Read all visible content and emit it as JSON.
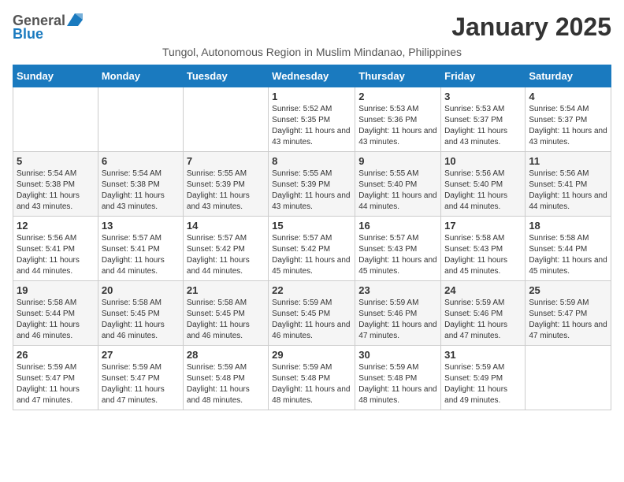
{
  "header": {
    "logo_general": "General",
    "logo_blue": "Blue",
    "month_title": "January 2025",
    "subtitle": "Tungol, Autonomous Region in Muslim Mindanao, Philippines"
  },
  "weekdays": [
    "Sunday",
    "Monday",
    "Tuesday",
    "Wednesday",
    "Thursday",
    "Friday",
    "Saturday"
  ],
  "weeks": [
    [
      {
        "day": "",
        "sunrise": "",
        "sunset": "",
        "daylight": ""
      },
      {
        "day": "",
        "sunrise": "",
        "sunset": "",
        "daylight": ""
      },
      {
        "day": "",
        "sunrise": "",
        "sunset": "",
        "daylight": ""
      },
      {
        "day": "1",
        "sunrise": "Sunrise: 5:52 AM",
        "sunset": "Sunset: 5:35 PM",
        "daylight": "Daylight: 11 hours and 43 minutes."
      },
      {
        "day": "2",
        "sunrise": "Sunrise: 5:53 AM",
        "sunset": "Sunset: 5:36 PM",
        "daylight": "Daylight: 11 hours and 43 minutes."
      },
      {
        "day": "3",
        "sunrise": "Sunrise: 5:53 AM",
        "sunset": "Sunset: 5:37 PM",
        "daylight": "Daylight: 11 hours and 43 minutes."
      },
      {
        "day": "4",
        "sunrise": "Sunrise: 5:54 AM",
        "sunset": "Sunset: 5:37 PM",
        "daylight": "Daylight: 11 hours and 43 minutes."
      }
    ],
    [
      {
        "day": "5",
        "sunrise": "Sunrise: 5:54 AM",
        "sunset": "Sunset: 5:38 PM",
        "daylight": "Daylight: 11 hours and 43 minutes."
      },
      {
        "day": "6",
        "sunrise": "Sunrise: 5:54 AM",
        "sunset": "Sunset: 5:38 PM",
        "daylight": "Daylight: 11 hours and 43 minutes."
      },
      {
        "day": "7",
        "sunrise": "Sunrise: 5:55 AM",
        "sunset": "Sunset: 5:39 PM",
        "daylight": "Daylight: 11 hours and 43 minutes."
      },
      {
        "day": "8",
        "sunrise": "Sunrise: 5:55 AM",
        "sunset": "Sunset: 5:39 PM",
        "daylight": "Daylight: 11 hours and 43 minutes."
      },
      {
        "day": "9",
        "sunrise": "Sunrise: 5:55 AM",
        "sunset": "Sunset: 5:40 PM",
        "daylight": "Daylight: 11 hours and 44 minutes."
      },
      {
        "day": "10",
        "sunrise": "Sunrise: 5:56 AM",
        "sunset": "Sunset: 5:40 PM",
        "daylight": "Daylight: 11 hours and 44 minutes."
      },
      {
        "day": "11",
        "sunrise": "Sunrise: 5:56 AM",
        "sunset": "Sunset: 5:41 PM",
        "daylight": "Daylight: 11 hours and 44 minutes."
      }
    ],
    [
      {
        "day": "12",
        "sunrise": "Sunrise: 5:56 AM",
        "sunset": "Sunset: 5:41 PM",
        "daylight": "Daylight: 11 hours and 44 minutes."
      },
      {
        "day": "13",
        "sunrise": "Sunrise: 5:57 AM",
        "sunset": "Sunset: 5:41 PM",
        "daylight": "Daylight: 11 hours and 44 minutes."
      },
      {
        "day": "14",
        "sunrise": "Sunrise: 5:57 AM",
        "sunset": "Sunset: 5:42 PM",
        "daylight": "Daylight: 11 hours and 44 minutes."
      },
      {
        "day": "15",
        "sunrise": "Sunrise: 5:57 AM",
        "sunset": "Sunset: 5:42 PM",
        "daylight": "Daylight: 11 hours and 45 minutes."
      },
      {
        "day": "16",
        "sunrise": "Sunrise: 5:57 AM",
        "sunset": "Sunset: 5:43 PM",
        "daylight": "Daylight: 11 hours and 45 minutes."
      },
      {
        "day": "17",
        "sunrise": "Sunrise: 5:58 AM",
        "sunset": "Sunset: 5:43 PM",
        "daylight": "Daylight: 11 hours and 45 minutes."
      },
      {
        "day": "18",
        "sunrise": "Sunrise: 5:58 AM",
        "sunset": "Sunset: 5:44 PM",
        "daylight": "Daylight: 11 hours and 45 minutes."
      }
    ],
    [
      {
        "day": "19",
        "sunrise": "Sunrise: 5:58 AM",
        "sunset": "Sunset: 5:44 PM",
        "daylight": "Daylight: 11 hours and 46 minutes."
      },
      {
        "day": "20",
        "sunrise": "Sunrise: 5:58 AM",
        "sunset": "Sunset: 5:45 PM",
        "daylight": "Daylight: 11 hours and 46 minutes."
      },
      {
        "day": "21",
        "sunrise": "Sunrise: 5:58 AM",
        "sunset": "Sunset: 5:45 PM",
        "daylight": "Daylight: 11 hours and 46 minutes."
      },
      {
        "day": "22",
        "sunrise": "Sunrise: 5:59 AM",
        "sunset": "Sunset: 5:45 PM",
        "daylight": "Daylight: 11 hours and 46 minutes."
      },
      {
        "day": "23",
        "sunrise": "Sunrise: 5:59 AM",
        "sunset": "Sunset: 5:46 PM",
        "daylight": "Daylight: 11 hours and 47 minutes."
      },
      {
        "day": "24",
        "sunrise": "Sunrise: 5:59 AM",
        "sunset": "Sunset: 5:46 PM",
        "daylight": "Daylight: 11 hours and 47 minutes."
      },
      {
        "day": "25",
        "sunrise": "Sunrise: 5:59 AM",
        "sunset": "Sunset: 5:47 PM",
        "daylight": "Daylight: 11 hours and 47 minutes."
      }
    ],
    [
      {
        "day": "26",
        "sunrise": "Sunrise: 5:59 AM",
        "sunset": "Sunset: 5:47 PM",
        "daylight": "Daylight: 11 hours and 47 minutes."
      },
      {
        "day": "27",
        "sunrise": "Sunrise: 5:59 AM",
        "sunset": "Sunset: 5:47 PM",
        "daylight": "Daylight: 11 hours and 47 minutes."
      },
      {
        "day": "28",
        "sunrise": "Sunrise: 5:59 AM",
        "sunset": "Sunset: 5:48 PM",
        "daylight": "Daylight: 11 hours and 48 minutes."
      },
      {
        "day": "29",
        "sunrise": "Sunrise: 5:59 AM",
        "sunset": "Sunset: 5:48 PM",
        "daylight": "Daylight: 11 hours and 48 minutes."
      },
      {
        "day": "30",
        "sunrise": "Sunrise: 5:59 AM",
        "sunset": "Sunset: 5:48 PM",
        "daylight": "Daylight: 11 hours and 48 minutes."
      },
      {
        "day": "31",
        "sunrise": "Sunrise: 5:59 AM",
        "sunset": "Sunset: 5:49 PM",
        "daylight": "Daylight: 11 hours and 49 minutes."
      },
      {
        "day": "",
        "sunrise": "",
        "sunset": "",
        "daylight": ""
      }
    ]
  ]
}
